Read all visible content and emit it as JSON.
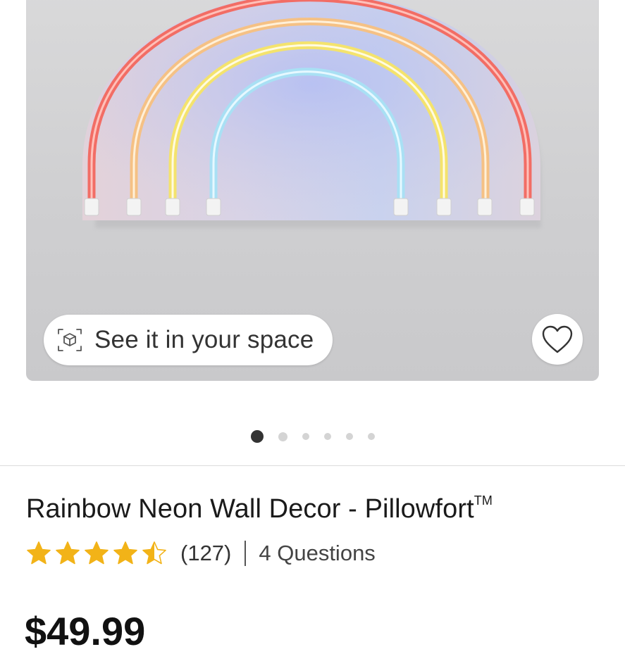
{
  "product": {
    "title": "Rainbow Neon Wall Decor - Pillowfort",
    "trademark": "TM",
    "rating": 4.5,
    "rating_max": 5,
    "review_count_label": "(127)",
    "questions_label": "4 Questions",
    "price": "$49.99"
  },
  "gallery": {
    "ar_button_label": "See it in your space",
    "ar_icon": "ar-cube-icon",
    "favorite_icon": "heart-icon",
    "image_count": 6,
    "active_index": 0
  },
  "colors": {
    "star": "#f2b318",
    "rainbow": [
      "#f06b63",
      "#f7c98a",
      "#f6ea7e",
      "#b9e6f5"
    ]
  }
}
